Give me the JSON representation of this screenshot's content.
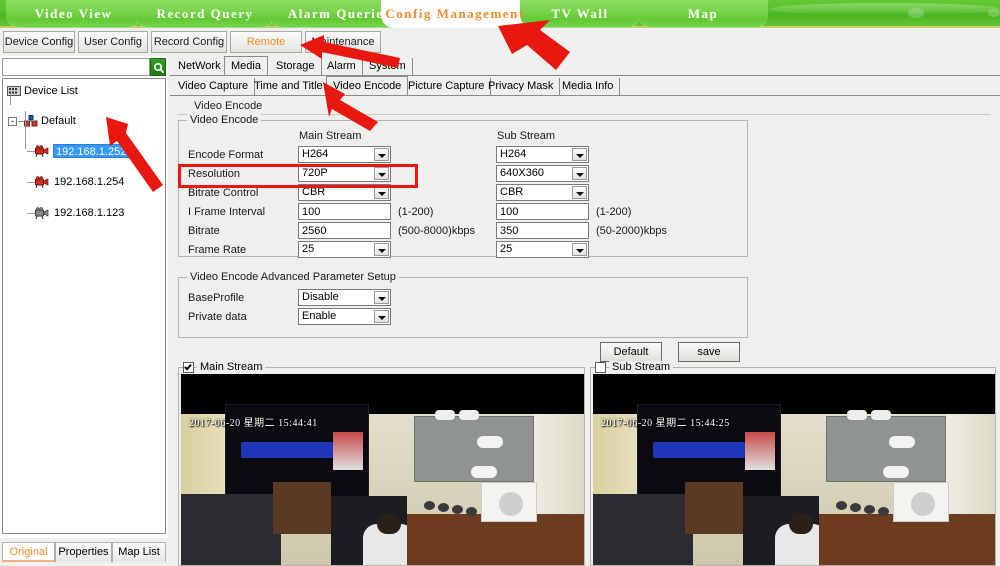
{
  "app": {
    "accent_green": "#63c934",
    "accent_orange": "#f08a2a",
    "annotation_red": "#e8170f",
    "selection_blue": "#3399ff"
  },
  "topnav": {
    "tabs": [
      {
        "label": "Video View",
        "active": false
      },
      {
        "label": "Record Query",
        "active": false
      },
      {
        "label": "Alarm Queries",
        "active": false
      },
      {
        "label": "Config Management",
        "active": true
      },
      {
        "label": "TV Wall",
        "active": false
      },
      {
        "label": "Map",
        "active": false
      }
    ]
  },
  "subnav": {
    "buttons": [
      {
        "label": "Device Config",
        "active": false
      },
      {
        "label": "User Config",
        "active": false
      },
      {
        "label": "Record Config",
        "active": false
      },
      {
        "label": "Remote Config",
        "active": true
      },
      {
        "label": "Maintenance",
        "active": false
      }
    ]
  },
  "sidebar": {
    "search": {
      "value": "",
      "placeholder": ""
    },
    "search_icon": "search-icon",
    "tree": {
      "root_label": "Device List",
      "group_label": "Default",
      "group_expander": "-",
      "devices": [
        {
          "ip": "192.168.1.252",
          "selected": true
        },
        {
          "ip": "192.168.1.254",
          "selected": false
        },
        {
          "ip": "192.168.1.123",
          "selected": false
        }
      ]
    },
    "bottom_tabs": [
      {
        "label": "Original",
        "active": true
      },
      {
        "label": "Properties",
        "active": false
      },
      {
        "label": "Map List",
        "active": false
      }
    ]
  },
  "main": {
    "tier1_tabs": [
      {
        "label": "NetWork",
        "active": false
      },
      {
        "label": "Media",
        "active": true
      },
      {
        "label": "Storage",
        "active": false
      },
      {
        "label": "Alarm",
        "active": false
      },
      {
        "label": "System",
        "active": false
      }
    ],
    "tier2_tabs": [
      {
        "label": "Video Capture",
        "active": false
      },
      {
        "label": "Time and Title",
        "active": false
      },
      {
        "label": "Video Encode",
        "active": true
      },
      {
        "label": "Picture Capture",
        "active": false
      },
      {
        "label": "Privacy Mask",
        "active": false
      },
      {
        "label": "Media Info",
        "active": false
      }
    ],
    "page_title": "Video Encode",
    "encode_group": {
      "title": "Video Encode",
      "col_main": "Main Stream",
      "col_sub": "Sub Stream",
      "rows": [
        {
          "label": "Encode Format",
          "control": "select",
          "main_value": "H264",
          "sub_value": "H264",
          "main_hint": "",
          "sub_hint": ""
        },
        {
          "label": "Resolution",
          "control": "select",
          "main_value": "720P",
          "sub_value": "640X360",
          "main_hint": "",
          "sub_hint": "",
          "highlighted": true
        },
        {
          "label": "Bitrate Control",
          "control": "select",
          "main_value": "CBR",
          "sub_value": "CBR",
          "main_hint": "",
          "sub_hint": ""
        },
        {
          "label": "I Frame Interval",
          "control": "text",
          "main_value": "100",
          "sub_value": "100",
          "main_hint": "(1-200)",
          "sub_hint": "(1-200)"
        },
        {
          "label": "Bitrate",
          "control": "text",
          "main_value": "2560",
          "sub_value": "350",
          "main_hint": "(500-8000)kbps",
          "sub_hint": "(50-2000)kbps"
        },
        {
          "label": "Frame Rate",
          "control": "select",
          "main_value": "25",
          "sub_value": "25",
          "main_hint": "",
          "sub_hint": ""
        }
      ]
    },
    "advanced_group": {
      "title": "Video Encode Advanced Parameter Setup",
      "rows": [
        {
          "label": "BaseProfile",
          "value": "Disable"
        },
        {
          "label": "Private data",
          "value": "Enable"
        }
      ]
    },
    "actions": {
      "default_label": "Default",
      "save_label": "save"
    },
    "previews": [
      {
        "title": "Main Stream",
        "checked": true,
        "overlay": "2017-06-20  星期二   15:44:41"
      },
      {
        "title": "Sub Stream",
        "checked": false,
        "overlay": "2017-06-20  星期二   15:44:25"
      }
    ]
  },
  "annotations": [
    {
      "name": "arrow-to-config-management",
      "kind": "arrow"
    },
    {
      "name": "arrow-to-remote-config",
      "kind": "arrow"
    },
    {
      "name": "arrow-to-video-encode-tab",
      "kind": "arrow"
    },
    {
      "name": "arrow-to-selected-device",
      "kind": "arrow"
    },
    {
      "name": "highlight-resolution-row",
      "kind": "rect"
    }
  ]
}
